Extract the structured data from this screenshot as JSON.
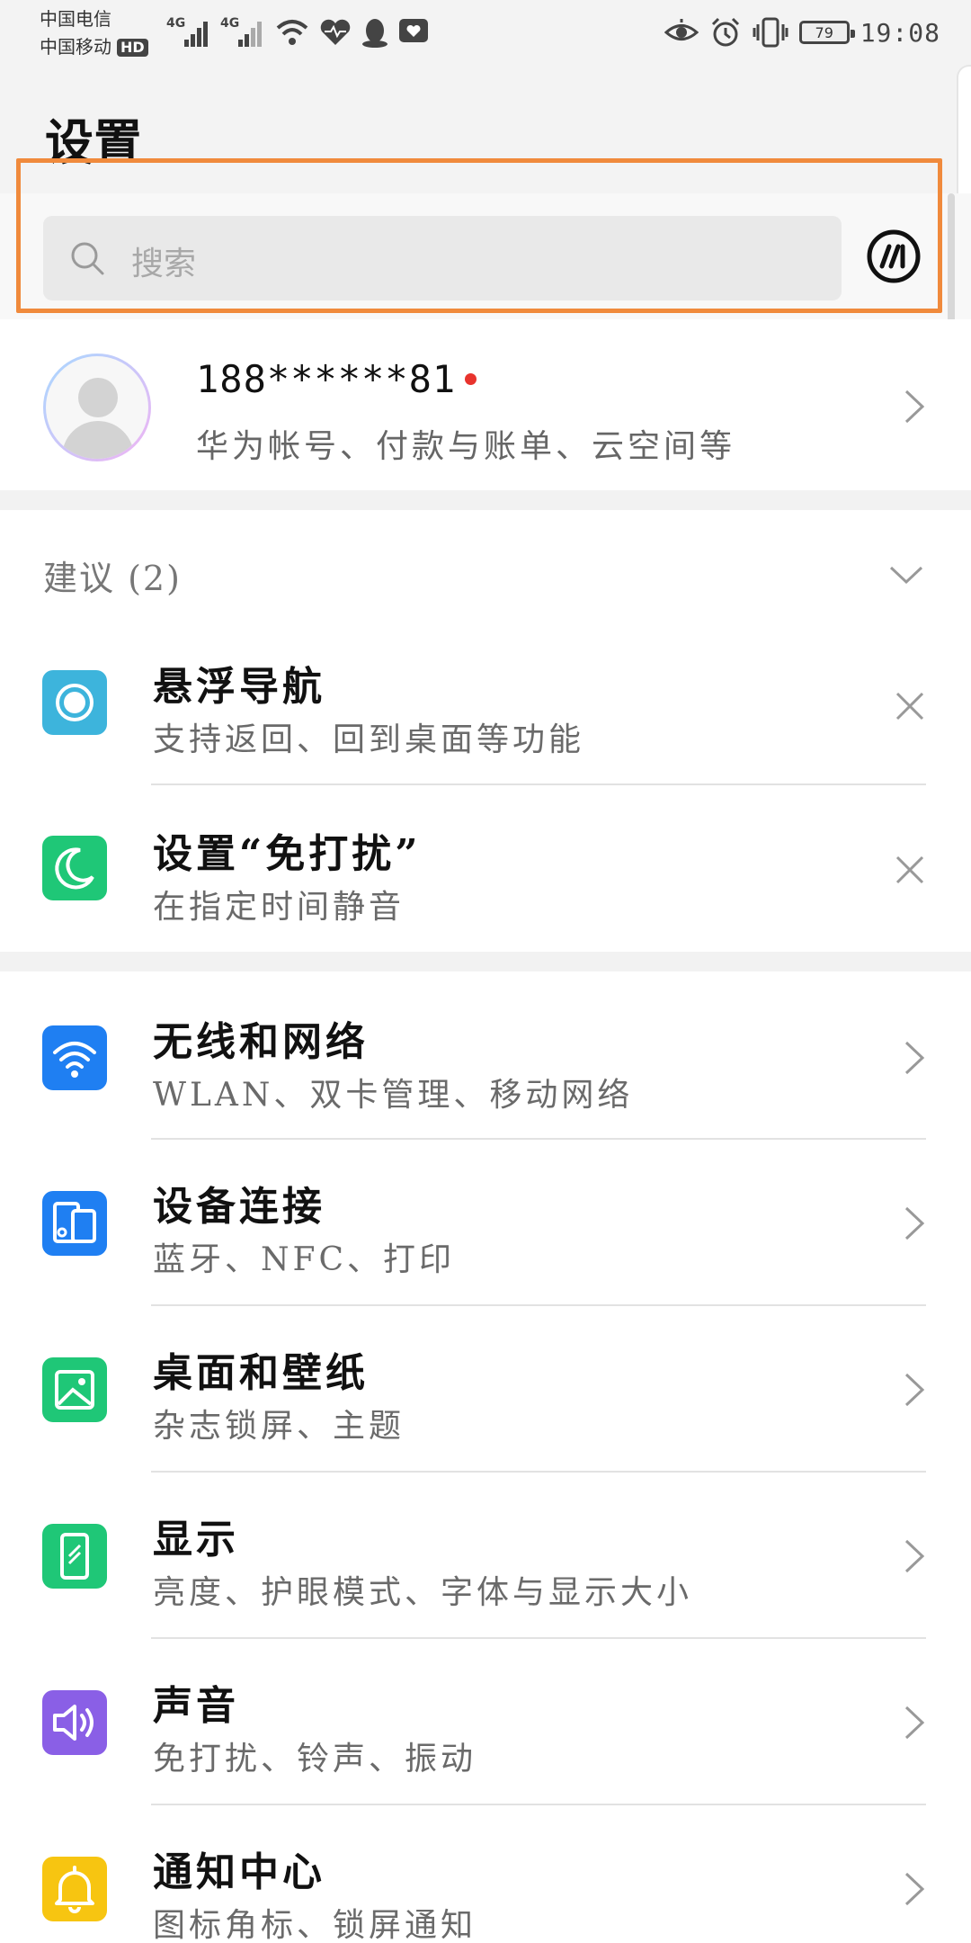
{
  "status_bar": {
    "carrier1": "中国电信",
    "carrier2": "中国移动",
    "hd_badge": "HD",
    "signal1_label": "4G",
    "signal2_label": "4G",
    "battery": "79",
    "time": "19:08"
  },
  "header": {
    "title": "设置"
  },
  "search": {
    "placeholder": "搜索"
  },
  "account": {
    "name": "188******81",
    "subtitle": "华为帐号、付款与账单、云空间等"
  },
  "suggestions": {
    "label": "建议 (2)",
    "items": [
      {
        "title": "悬浮导航",
        "subtitle": "支持返回、回到桌面等功能",
        "icon": "floating-nav-icon",
        "color": "#3db4dc"
      },
      {
        "title": "设置“免打扰”",
        "subtitle": "在指定时间静音",
        "icon": "moon-icon",
        "color": "#1fc777"
      }
    ]
  },
  "settings": [
    {
      "title": "无线和网络",
      "subtitle": "WLAN、双卡管理、移动网络",
      "icon": "wifi-icon",
      "color": "#1f7ff2"
    },
    {
      "title": "设备连接",
      "subtitle": "蓝牙、NFC、打印",
      "icon": "device-connection-icon",
      "color": "#1f7ff2"
    },
    {
      "title": "桌面和壁纸",
      "subtitle": "杂志锁屏、主题",
      "icon": "wallpaper-icon",
      "color": "#1fc777"
    },
    {
      "title": "显示",
      "subtitle": "亮度、护眼模式、字体与显示大小",
      "icon": "display-icon",
      "color": "#1fc777"
    },
    {
      "title": "声音",
      "subtitle": "免打扰、铃声、振动",
      "icon": "sound-icon",
      "color": "#8a5fe6"
    },
    {
      "title": "通知中心",
      "subtitle": "图标角标、锁屏通知",
      "icon": "bell-icon",
      "color": "#f7c511"
    }
  ]
}
